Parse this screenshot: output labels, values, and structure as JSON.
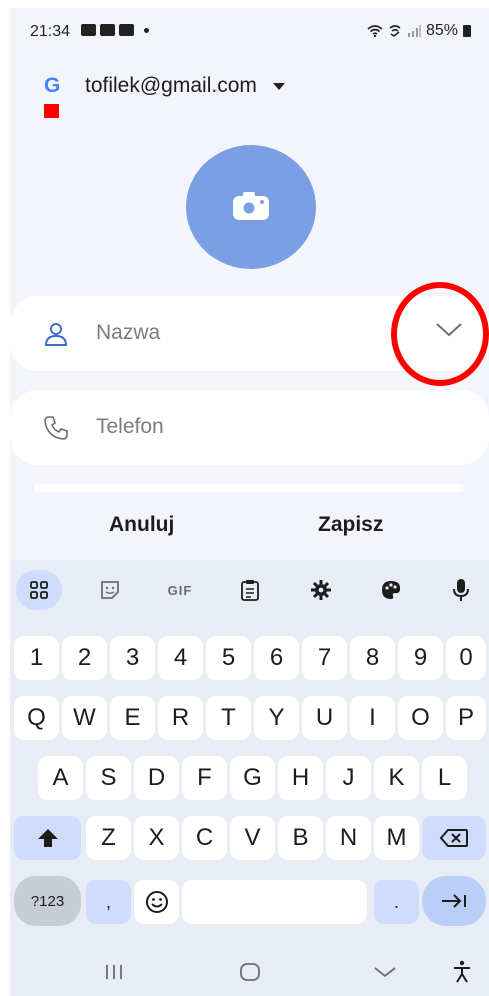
{
  "status_bar": {
    "time": "21:34",
    "battery": "85%"
  },
  "account": {
    "email": "tofilek@gmail.com",
    "logo_letter": "G"
  },
  "fields": [
    {
      "label": "Nazwa",
      "icon": "person-icon"
    },
    {
      "label": "Telefon",
      "icon": "phone-icon"
    }
  ],
  "actions": {
    "cancel": "Anuluj",
    "save": "Zapisz"
  },
  "keyboard": {
    "toolbar": {
      "gif": "GIF"
    },
    "row_numbers": [
      "1",
      "2",
      "3",
      "4",
      "5",
      "6",
      "7",
      "8",
      "9",
      "0"
    ],
    "row_top": [
      "Q",
      "W",
      "E",
      "R",
      "T",
      "Y",
      "U",
      "I",
      "O",
      "P"
    ],
    "row_middle": [
      "A",
      "S",
      "D",
      "F",
      "G",
      "H",
      "J",
      "K",
      "L"
    ],
    "row_bottom": [
      "Z",
      "X",
      "C",
      "V",
      "B",
      "N",
      "M"
    ],
    "sym_key": "?123",
    "comma": ",",
    "period": "."
  },
  "colors": {
    "accent": "#7a9fe4",
    "highlight_circle": "#ff0000",
    "keyboard_bg": "#e8ecf4"
  }
}
